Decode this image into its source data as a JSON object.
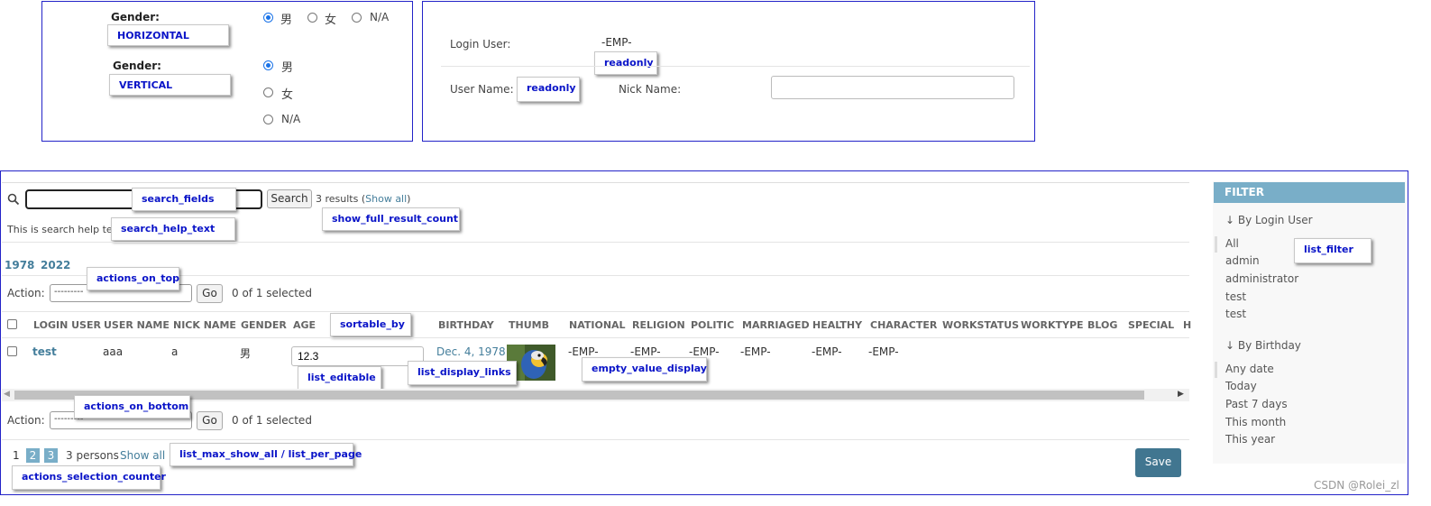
{
  "gender_panel": {
    "label1": "Gender:",
    "tag1": "HORIZONTAL",
    "label2": "Gender:",
    "tag2": "VERTICAL",
    "options": [
      "男",
      "女",
      "N/A"
    ]
  },
  "user_panel": {
    "login_user_label": "Login User:",
    "login_user_value": "-EMP-",
    "readonly_tag1": "readonly",
    "user_name_label": "User Name:",
    "readonly_tag2": "readonly",
    "nick_name_label": "Nick Name:",
    "nick_name_value": ""
  },
  "search": {
    "value": "",
    "tag": "search_fields",
    "button": "Search",
    "result_text": "3 results (",
    "show_all": "Show all",
    "result_close": ")",
    "result_tag": "show_full_result_count",
    "help_text": "This is search help text.",
    "help_tag": "search_help_text"
  },
  "date_hierarchy": {
    "years": [
      "1978",
      "2022"
    ]
  },
  "actions_top": {
    "label": "Action:",
    "select_value": "---------",
    "go": "Go",
    "counter": "0 of 1 selected",
    "tag": "actions_on_top"
  },
  "table": {
    "columns": [
      "LOGIN USER",
      "USER NAME",
      "NICK NAME",
      "GENDER",
      "AGE",
      "BIRTHDAY",
      "THUMB",
      "NATIONAL",
      "RELIGION",
      "POLITIC",
      "MARRIAGED",
      "HEALTHY",
      "CHARACTER",
      "WORKSTATUS",
      "WORKTYPE",
      "BLOG",
      "SPECIAL",
      "H"
    ],
    "sortable_tag": "sortable_by",
    "row": {
      "login_user": "test",
      "user_name": "aaa",
      "nick_name": "a",
      "gender": "男",
      "age": "12.3",
      "birthday": "Dec. 4, 1978",
      "national": "-EMP-",
      "religion": "-EMP-",
      "politic": "-EMP-",
      "marriaged": "-EMP-",
      "healthy": "-EMP-",
      "character": "-EMP-"
    },
    "editable_tag": "list_editable",
    "links_tag": "list_display_links",
    "empty_tag": "empty_value_display"
  },
  "actions_bottom": {
    "label": "Action:",
    "select_value": "---------",
    "go": "Go",
    "counter": "0 of 1 selected",
    "tag": "actions_on_bottom"
  },
  "pagination": {
    "current": "1",
    "pages": [
      "2",
      "3"
    ],
    "count": "3 persons",
    "show_all": "Show all",
    "tag": "list_max_show_all / list_per_page",
    "counter_tag": "actions_selection_counter",
    "save": "Save"
  },
  "filter": {
    "header": "FILTER",
    "group1_title": "↓ By Login User",
    "group1_items": [
      "All",
      "admin",
      "administrator",
      "test",
      "test"
    ],
    "tag": "list_filter",
    "group2_title": "↓ By Birthday",
    "group2_items": [
      "Any date",
      "Today",
      "Past 7 days",
      "This month",
      "This year"
    ]
  },
  "watermark": "CSDN @Rolei_zl",
  "colors": {
    "frame": "#2323c8",
    "tag_text": "#0a14c8",
    "filter_header": "#79aec8",
    "link": "#447e9b",
    "save": "#417690"
  }
}
